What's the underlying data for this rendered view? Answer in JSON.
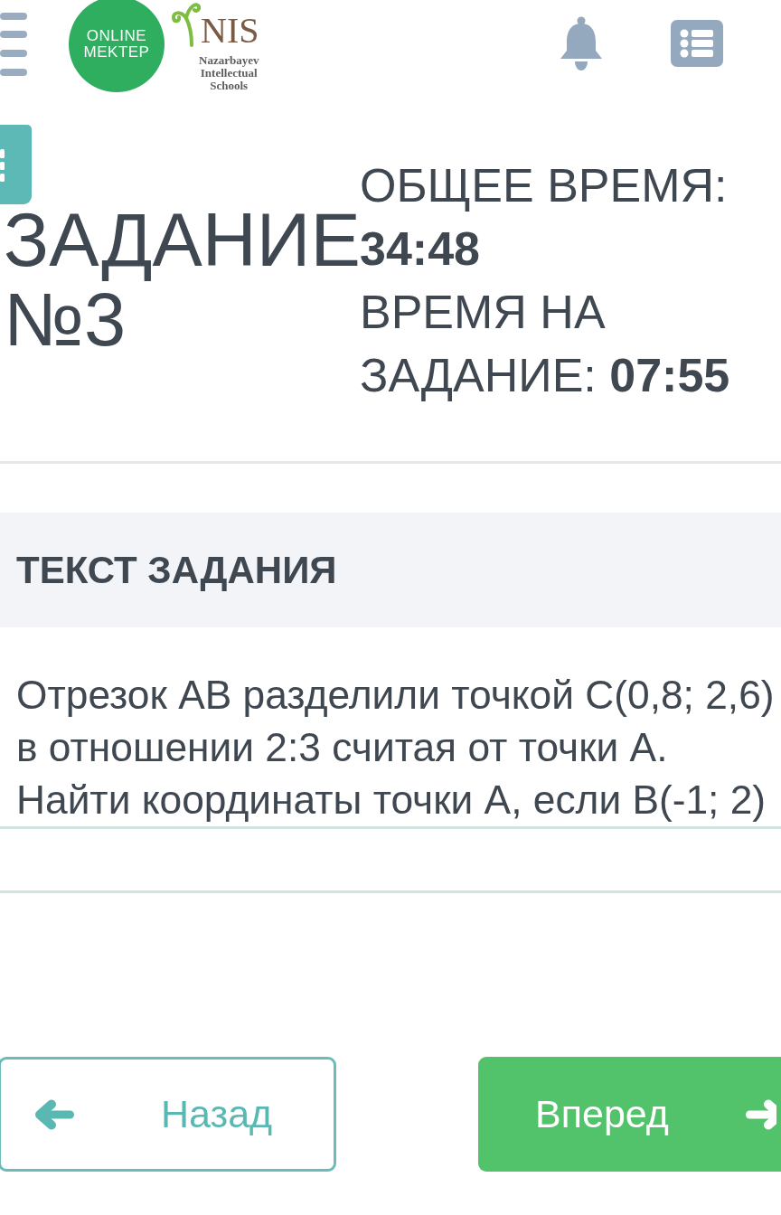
{
  "header": {
    "logo_text": "ONLINE MEKTEP",
    "partner_logo": {
      "name": "NIS",
      "subtitle": "Nazarbayev Intellectual Schools"
    }
  },
  "task": {
    "title": "ЗАДАНИЕ №3",
    "timers": [
      {
        "label": "ОБЩЕЕ ВРЕМЯ:",
        "value": "34:48"
      },
      {
        "label": "ВРЕМЯ НА ЗАДАНИЕ:",
        "value": "07:55"
      }
    ]
  },
  "task_text": {
    "heading": "ТЕКСТ ЗАДАНИЯ",
    "body": "Отрезок АВ разделили точкой С(0,8; 2,6) в отношении 2:3 считая от точки А. Найти координаты точки А, если В(-1; 2)"
  },
  "navigation": {
    "buttons": [
      {
        "kind": "back",
        "label": "Назад"
      },
      {
        "kind": "forward",
        "label": "Вперед"
      }
    ]
  }
}
